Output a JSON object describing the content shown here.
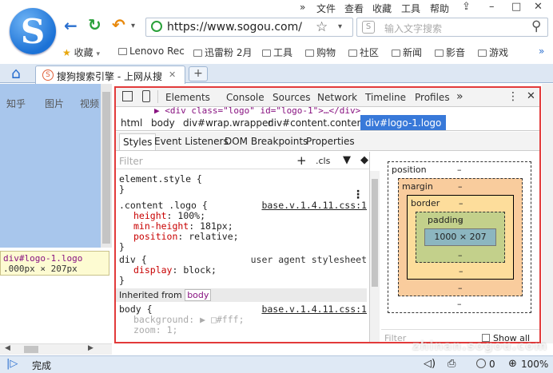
{
  "menu": {
    "chevron": "»",
    "items": [
      "文件",
      "查看",
      "收藏",
      "工具",
      "帮助"
    ]
  },
  "window": {
    "skin": "⇪",
    "minimize": "–",
    "maximize": "□",
    "close": "✕"
  },
  "logo": {
    "letter": "S"
  },
  "nav": {
    "back": "←",
    "refresh": "↻",
    "undo": "↶",
    "dropdown": "▾",
    "url": "https://www.sogou.com/",
    "star": "☆",
    "search_placeholder": "输入文字搜索",
    "search_icon": "⚲"
  },
  "bookmarks": {
    "items": [
      "收藏",
      "Lenovo Rec",
      "迅雷粉 2月",
      "工具",
      "购物",
      "社区",
      "新闻",
      "影音",
      "游戏"
    ],
    "more": "»"
  },
  "tabs": {
    "home_icon": "⌂",
    "active_title": "搜狗搜索引擎 - 上网从搜",
    "close": "✕",
    "new_tab": "+"
  },
  "page": {
    "links": [
      "知乎",
      "图片",
      "视频"
    ],
    "tooltip_line1": "div#logo-1.logo",
    "tooltip_line2": ".000px × 207px"
  },
  "devtools": {
    "tabs": [
      "Elements",
      "Console",
      "Sources",
      "Network",
      "Timeline",
      "Profiles"
    ],
    "more": "»",
    "menu": "⋮",
    "close": "✕",
    "dom_line": "▶ <div class=\"logo\" id=\"logo-1\">…</div>",
    "breadcrumbs": [
      "html",
      "body",
      "div#wrap.wrapper",
      "div#content.content",
      "div#logo-1.logo"
    ],
    "subtabs": [
      "Styles",
      "Event Listeners",
      "DOM Breakpoints",
      "Properties"
    ],
    "filter_placeholder": "Filter",
    "cls": ".cls",
    "plus": "+",
    "rules": {
      "element_style": "element.style {",
      "close_brace": "}",
      "content_logo_selector": ".content .logo {",
      "content_logo_source": "base.v.1.4.11.css:1",
      "height": "height",
      "height_val": "100%;",
      "min_height": "min-height",
      "min_height_val": "181px;",
      "position": "position",
      "position_val": "relative;",
      "div_selector": "div {",
      "div_source": "user agent stylesheet",
      "display": "display",
      "display_val": "block;",
      "inherited_from": "Inherited from",
      "inherited_tag": "body",
      "body_selector": "body {",
      "body_source": "base.v.1.4.11.css:1",
      "background": "background",
      "background_val": "▶ □#fff;",
      "zoom": "zoom",
      "zoom_val": "1;"
    },
    "boxmodel": {
      "position_label": "position",
      "margin_label": "margin",
      "border_label": "border",
      "padding_label": "padding",
      "content": "1000 × 207",
      "dash": "–",
      "filter_placeholder": "Filter",
      "show_all": "Show all"
    }
  },
  "status": {
    "text": "完成",
    "zoom": "100%",
    "count": "0"
  },
  "watermark": "zhinan.sogou.com"
}
